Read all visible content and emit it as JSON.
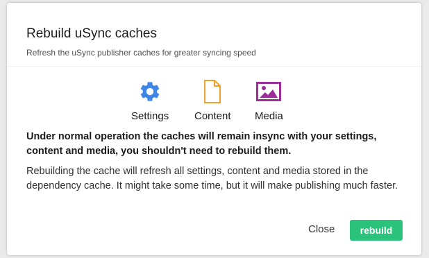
{
  "dialog": {
    "title": "Rebuild uSync caches",
    "subtitle": "Refresh the uSync publisher caches for greater syncing speed",
    "cache_types": [
      {
        "label": "Settings",
        "icon": "gear-icon",
        "color": "#3f86e6"
      },
      {
        "label": "Content",
        "icon": "document-icon",
        "color": "#f0a02a"
      },
      {
        "label": "Media",
        "icon": "image-icon",
        "color": "#9b2e9a"
      }
    ],
    "warning": "Under normal operation the caches will remain insync with your settings, content and media, you shouldn't need to rebuild them.",
    "info": "Rebuilding the cache will refresh all settings, content and media stored in the dependency cache. It might take some time, but it will make publishing much faster.",
    "close_label": "Close",
    "rebuild_label": "rebuild",
    "accent_color": "#2bc37c"
  }
}
